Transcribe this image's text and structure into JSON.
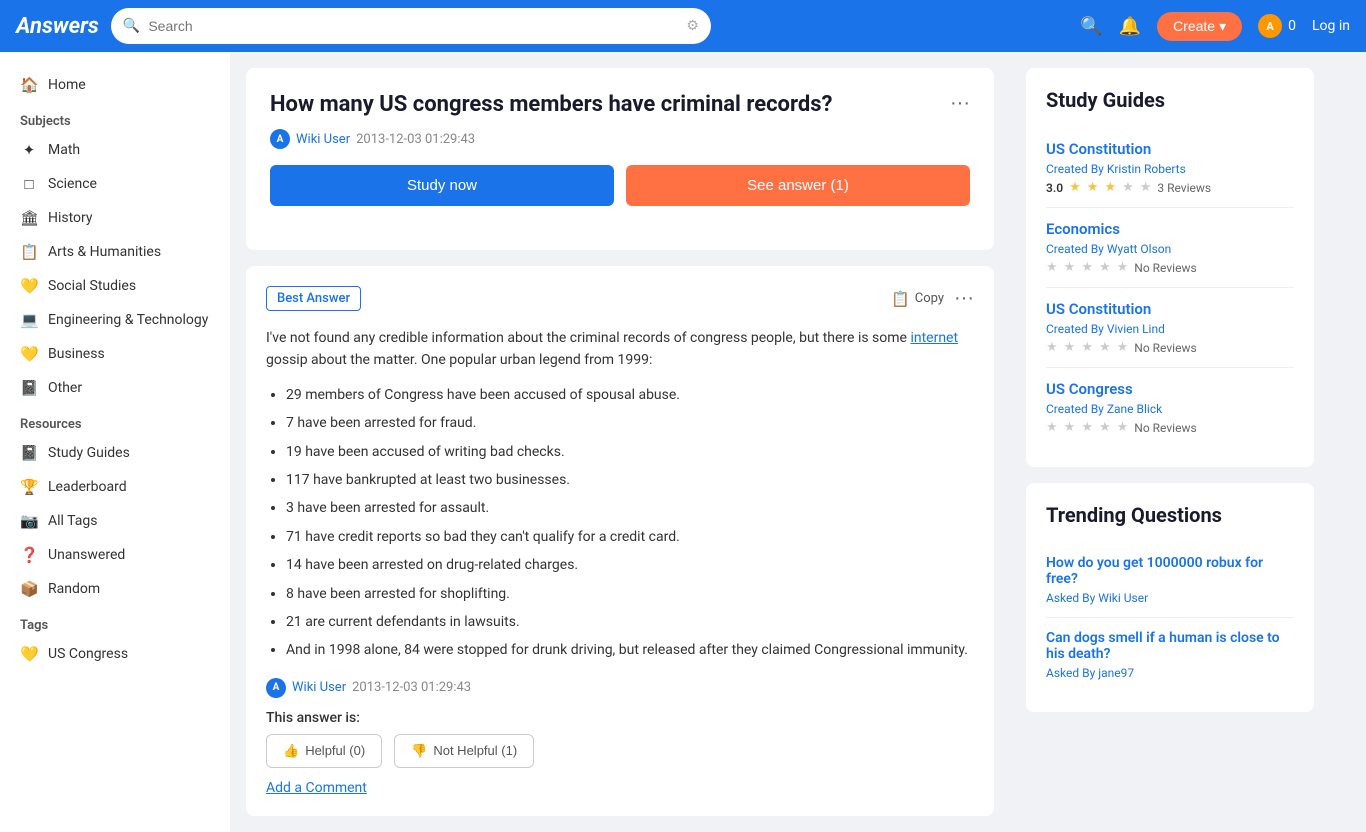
{
  "header": {
    "logo": "Answers",
    "search_placeholder": "Search",
    "create_label": "Create",
    "coins_count": "0",
    "login_label": "Log in"
  },
  "sidebar": {
    "home_label": "Home",
    "subjects_title": "Subjects",
    "subjects": [
      {
        "id": "math",
        "label": "Math",
        "icon": "✦"
      },
      {
        "id": "science",
        "label": "Science",
        "icon": "□"
      },
      {
        "id": "history",
        "label": "History",
        "icon": "🏛"
      },
      {
        "id": "arts",
        "label": "Arts & Humanities",
        "icon": "📋"
      },
      {
        "id": "social",
        "label": "Social Studies",
        "icon": "💛"
      },
      {
        "id": "engineering",
        "label": "Engineering & Technology",
        "icon": "💻"
      },
      {
        "id": "business",
        "label": "Business",
        "icon": "💛"
      },
      {
        "id": "other",
        "label": "Other",
        "icon": "📓"
      }
    ],
    "resources_title": "Resources",
    "resources": [
      {
        "id": "study-guides",
        "label": "Study Guides",
        "icon": "📓"
      },
      {
        "id": "leaderboard",
        "label": "Leaderboard",
        "icon": "🏆"
      },
      {
        "id": "all-tags",
        "label": "All Tags",
        "icon": "📷"
      },
      {
        "id": "unanswered",
        "label": "Unanswered",
        "icon": "❓"
      },
      {
        "id": "random",
        "label": "Random",
        "icon": "📦"
      }
    ],
    "tags_title": "Tags",
    "tags": [
      {
        "id": "us-congress",
        "label": "US Congress",
        "icon": "💛"
      }
    ]
  },
  "question": {
    "title": "How many US congress members have criminal records?",
    "author": "Wiki User",
    "date": "2013-12-03 01:29:43",
    "study_now_label": "Study now",
    "see_answer_label": "See answer (1)"
  },
  "answer": {
    "best_answer_label": "Best Answer",
    "copy_label": "Copy",
    "body_intro": "I've not found any credible information about the criminal records of congress people, but there is some ",
    "body_link": "internet",
    "body_after": " gossip about the matter. One popular urban legend from 1999:",
    "bullets": [
      "29 members of Congress have been accused of spousal abuse.",
      "7 have been arrested for fraud.",
      "19 have been accused of writing bad checks.",
      "117 have bankrupted at least two businesses.",
      "3 have been arrested for assault.",
      "71 have credit reports so bad they can't qualify for a credit card.",
      "14 have been arrested on drug-related charges.",
      "8 have been arrested for shoplifting.",
      "21 are current defendants in lawsuits.",
      "And in 1998 alone, 84 were stopped for drunk driving, but released after they claimed Congressional immunity."
    ],
    "footer_author": "Wiki User",
    "footer_date": "2013-12-03 01:29:43",
    "this_answer_is": "This answer is:",
    "helpful_label": "Helpful (0)",
    "not_helpful_label": "Not Helpful (1)",
    "add_comment_label": "Add a Comment"
  },
  "study_guides": {
    "title": "Study Guides",
    "items": [
      {
        "title": "US Constitution",
        "creator_prefix": "Created By",
        "creator": "Kristin Roberts",
        "rating": "3.0",
        "stars": [
          1,
          1,
          1,
          0,
          0
        ],
        "reviews": "3 Reviews"
      },
      {
        "title": "Economics",
        "creator_prefix": "Created By",
        "creator": "Wyatt Olson",
        "rating": null,
        "stars": [
          0,
          0,
          0,
          0,
          0
        ],
        "reviews": "No Reviews"
      },
      {
        "title": "US Constitution",
        "creator_prefix": "Created By",
        "creator": "Vivien Lind",
        "rating": null,
        "stars": [
          0,
          0,
          0,
          0,
          0
        ],
        "reviews": "No Reviews"
      },
      {
        "title": "US Congress",
        "creator_prefix": "Created By",
        "creator": "Zane Blick",
        "rating": null,
        "stars": [
          0,
          0,
          0,
          0,
          0
        ],
        "reviews": "No Reviews"
      }
    ]
  },
  "trending": {
    "title": "Trending Questions",
    "items": [
      {
        "question": "How do you get 1000000 robux for free?",
        "asked_by_prefix": "Asked By",
        "asked_by": "Wiki User"
      },
      {
        "question": "Can dogs smell if a human is close to his death?",
        "asked_by_prefix": "Asked By",
        "asked_by": "jane97"
      }
    ]
  }
}
